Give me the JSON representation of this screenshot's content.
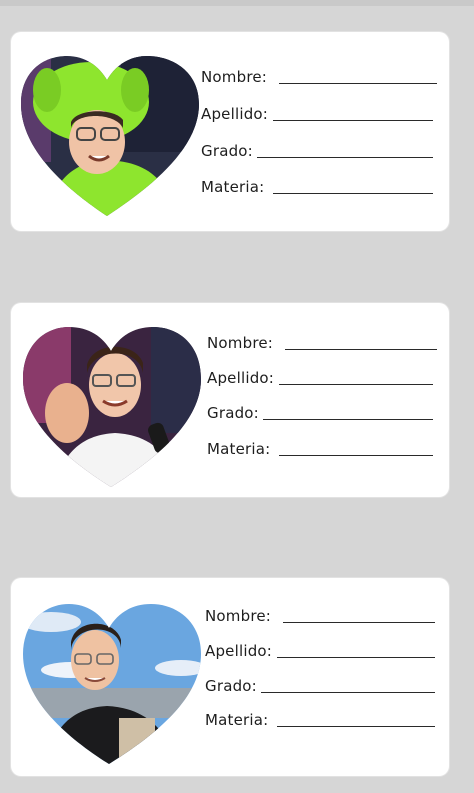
{
  "cards": [
    {
      "photo": "streamer-green-costume",
      "fields": [
        {
          "label": "Nombre:"
        },
        {
          "label": "Apellido:"
        },
        {
          "label": "Grado:"
        },
        {
          "label": "Materia:"
        }
      ]
    },
    {
      "photo": "streamer-finger-heart",
      "fields": [
        {
          "label": "Nombre:"
        },
        {
          "label": "Apellido:"
        },
        {
          "label": "Grado:"
        },
        {
          "label": "Materia:"
        }
      ]
    },
    {
      "photo": "man-outdoor-sky",
      "fields": [
        {
          "label": "Nombre:"
        },
        {
          "label": "Apellido:"
        },
        {
          "label": "Grado:"
        },
        {
          "label": "Materia:"
        }
      ]
    }
  ],
  "colors": {
    "background": "#d6d6d6",
    "card": "#ffffff",
    "costume_green": "#8ee52e",
    "sky_blue": "#6aa6e0"
  }
}
